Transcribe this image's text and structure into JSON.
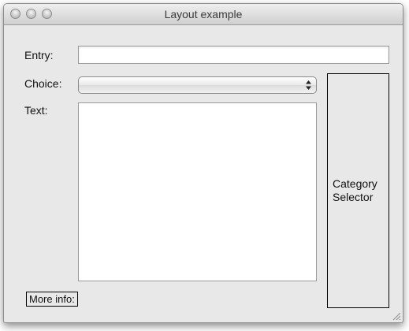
{
  "window": {
    "title": "Layout example"
  },
  "form": {
    "entry_label": "Entry:",
    "entry_value": "",
    "choice_label": "Choice:",
    "choice_value": "",
    "text_label": "Text:",
    "text_value": ""
  },
  "category_selector": {
    "line1": "Category",
    "line2": "Selector"
  },
  "more_info_label": "More info:",
  "icons": {
    "close": "close-icon",
    "minimize": "minimize-icon",
    "zoom": "zoom-icon",
    "popup_arrows": "up-down-arrows-icon",
    "resize": "resize-grip-icon"
  }
}
